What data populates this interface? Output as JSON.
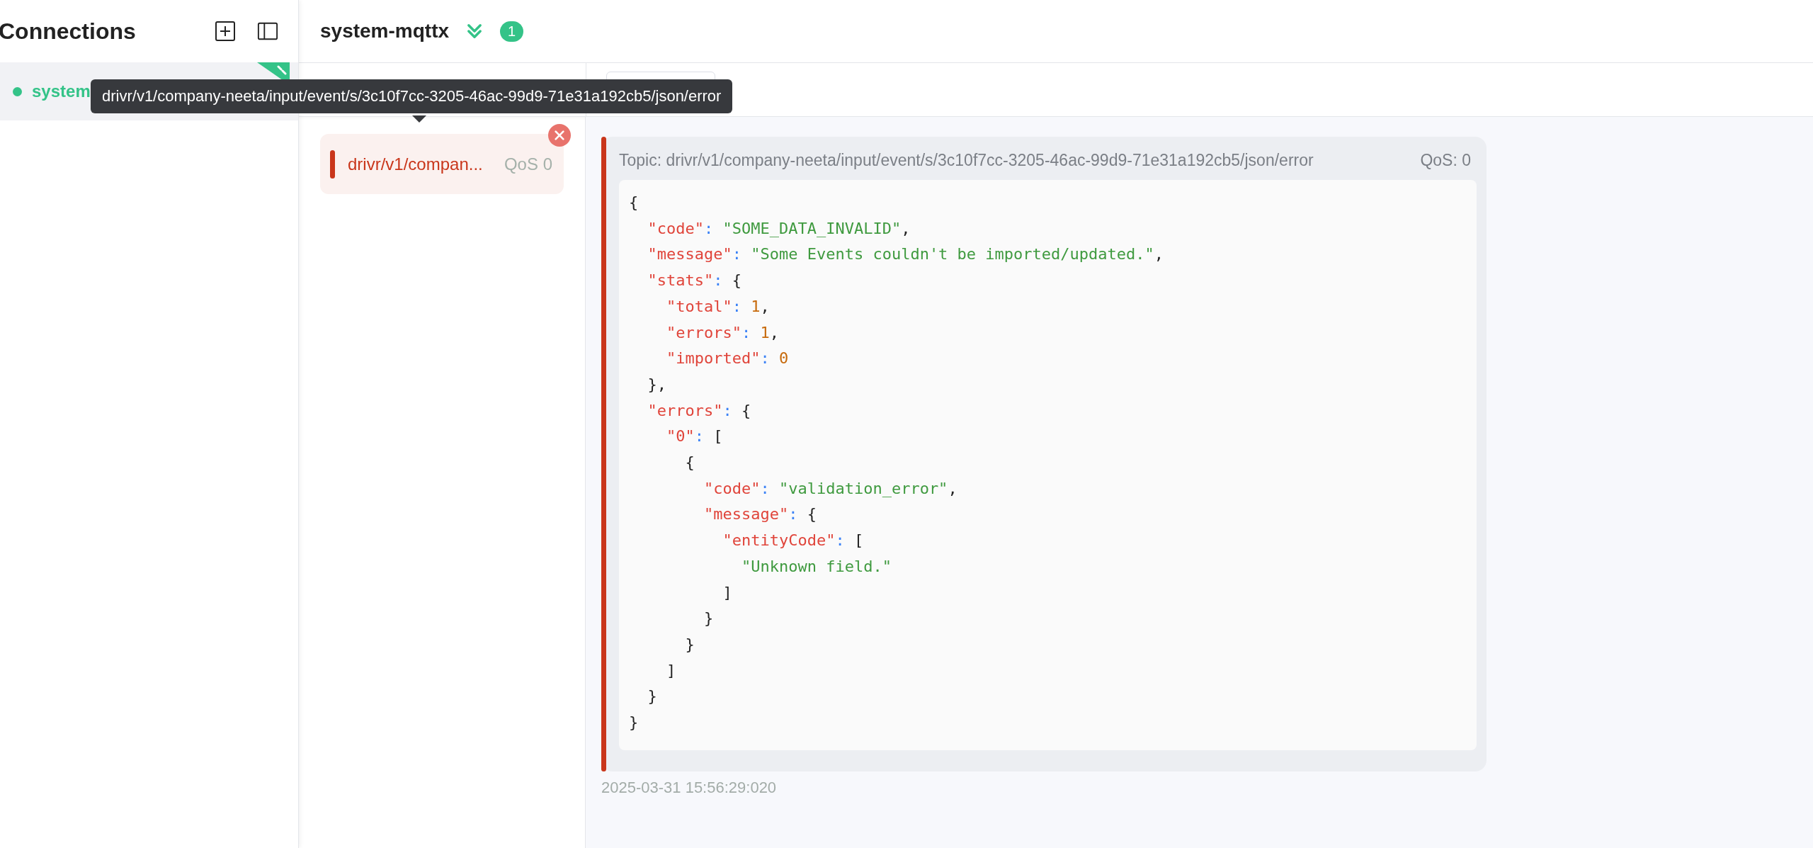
{
  "sidebar": {
    "title": "Connections",
    "connections": [
      {
        "name": "system",
        "color": "#34c388",
        "selected": true
      }
    ]
  },
  "header": {
    "title": "system-mqttx",
    "unread": "1"
  },
  "tooltip": "drivr/v1/company-neeta/input/event/s/3c10f7cc-3205-46ac-99d9-71e31a192cb5/json/error",
  "subscriptions": [
    {
      "topic": "drivr/v1/compan...",
      "qos": "QoS 0",
      "color": "#c9361b"
    }
  ],
  "messages": [
    {
      "topic": "Topic: drivr/v1/company-neeta/input/event/s/3c10f7cc-3205-46ac-99d9-71e31a192cb5/json/error",
      "qos": "QoS: 0",
      "color": "#c9361b",
      "time": "2025-03-31 15:56:29:020",
      "payload": [
        "{",
        "  \"code\": \"SOME_DATA_INVALID\",",
        "  \"message\": \"Some Events couldn't be imported/updated.\",",
        "  \"stats\": {",
        "    \"total\": 1,",
        "    \"errors\": 1,",
        "    \"imported\": 0",
        "  },",
        "  \"errors\": {",
        "    \"0\": [",
        "      {",
        "        \"code\": \"validation_error\",",
        "        \"message\": {",
        "          \"entityCode\": [",
        "            \"Unknown field.\"",
        "          ]",
        "        }",
        "      }",
        "    ]",
        "  }",
        "}"
      ]
    }
  ]
}
